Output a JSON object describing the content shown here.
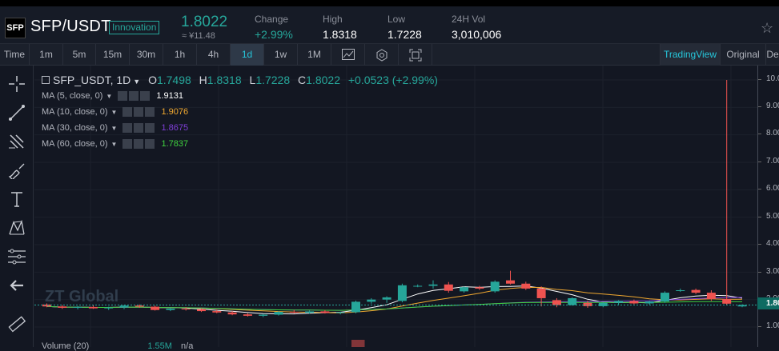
{
  "header": {
    "logo_text": "SFP",
    "pair": "SFP/USDT",
    "badge": "Innovation",
    "price": "1.8022",
    "price_cny": "≈ ¥11.48",
    "change_label": "Change",
    "change_value": "+2.99%",
    "high_label": "High",
    "high_value": "1.8318",
    "low_label": "Low",
    "low_value": "1.7228",
    "vol_label": "24H Vol",
    "vol_value": "3,010,006"
  },
  "timeframes": [
    "Time",
    "1m",
    "5m",
    "15m",
    "30m",
    "1h",
    "4h",
    "1d",
    "1w",
    "1M"
  ],
  "active_timeframe": "1d",
  "icons": [
    "bar-chart-icon",
    "settings-hex-icon",
    "fullscreen-icon"
  ],
  "views": {
    "tradingview": "TradingView",
    "original": "Original",
    "depth": "De"
  },
  "toolbar_icons": [
    "crosshair-icon",
    "trend-line-icon",
    "fib-icon",
    "brush-icon",
    "text-icon",
    "pattern-icon",
    "measure-icon",
    "back-arrow-icon",
    "ruler-icon"
  ],
  "legend": {
    "symbol": "SFP_USDT, 1D",
    "o_key": "O",
    "o_val": "1.7498",
    "h_key": "H",
    "h_val": "1.8318",
    "l_key": "L",
    "l_val": "1.7228",
    "c_key": "C",
    "c_val": "1.8022",
    "chg": "+0.0523 (+2.99%)"
  },
  "mas": [
    {
      "label": "MA (5, close, 0)",
      "value": "1.9131",
      "color": "#ffffff"
    },
    {
      "label": "MA (10, close, 0)",
      "value": "1.9076",
      "color": "#f0a830"
    },
    {
      "label": "MA (30, close, 0)",
      "value": "1.8675",
      "color": "#7e3ed6"
    },
    {
      "label": "MA (60, close, 0)",
      "value": "1.7837",
      "color": "#3fd23f"
    }
  ],
  "volume_row": {
    "label": "Volume (20)",
    "value": "1.55M",
    "extra": "n/a"
  },
  "watermark": "ZT Global",
  "yaxis_ticks": [
    "10.0",
    "9.00",
    "8.00",
    "7.00",
    "6.00",
    "5.00",
    "4.00",
    "3.00",
    "2.00",
    "1.00"
  ],
  "current_price_label": "1.80",
  "chart_data": {
    "type": "candlestick",
    "ylim": [
      0.6,
      10.3
    ],
    "candles": [
      {
        "o": 1.82,
        "h": 1.86,
        "l": 1.72,
        "c": 1.75
      },
      {
        "o": 1.75,
        "h": 1.8,
        "l": 1.66,
        "c": 1.7
      },
      {
        "o": 1.7,
        "h": 1.76,
        "l": 1.64,
        "c": 1.73
      },
      {
        "o": 1.73,
        "h": 1.79,
        "l": 1.66,
        "c": 1.68
      },
      {
        "o": 1.68,
        "h": 1.74,
        "l": 1.62,
        "c": 1.71
      },
      {
        "o": 1.71,
        "h": 1.8,
        "l": 1.65,
        "c": 1.78
      },
      {
        "o": 1.78,
        "h": 1.82,
        "l": 1.7,
        "c": 1.74
      },
      {
        "o": 1.74,
        "h": 1.78,
        "l": 1.6,
        "c": 1.62
      },
      {
        "o": 1.62,
        "h": 1.7,
        "l": 1.58,
        "c": 1.67
      },
      {
        "o": 1.67,
        "h": 1.72,
        "l": 1.6,
        "c": 1.65
      },
      {
        "o": 1.65,
        "h": 1.68,
        "l": 1.55,
        "c": 1.58
      },
      {
        "o": 1.58,
        "h": 1.64,
        "l": 1.5,
        "c": 1.53
      },
      {
        "o": 1.53,
        "h": 1.58,
        "l": 1.43,
        "c": 1.46
      },
      {
        "o": 1.46,
        "h": 1.5,
        "l": 1.38,
        "c": 1.41
      },
      {
        "o": 1.41,
        "h": 1.48,
        "l": 1.36,
        "c": 1.45
      },
      {
        "o": 1.45,
        "h": 1.58,
        "l": 1.42,
        "c": 1.55
      },
      {
        "o": 1.55,
        "h": 1.62,
        "l": 1.5,
        "c": 1.52
      },
      {
        "o": 1.52,
        "h": 1.6,
        "l": 1.48,
        "c": 1.57
      },
      {
        "o": 1.57,
        "h": 1.62,
        "l": 1.49,
        "c": 1.51
      },
      {
        "o": 1.51,
        "h": 1.56,
        "l": 1.46,
        "c": 1.54
      },
      {
        "o": 1.54,
        "h": 1.96,
        "l": 1.5,
        "c": 1.92
      },
      {
        "o": 1.92,
        "h": 2.05,
        "l": 1.85,
        "c": 2.0
      },
      {
        "o": 2.0,
        "h": 2.12,
        "l": 1.88,
        "c": 2.08
      },
      {
        "o": 1.95,
        "h": 2.58,
        "l": 1.9,
        "c": 2.52
      },
      {
        "o": 2.5,
        "h": 2.55,
        "l": 2.45,
        "c": 2.5
      },
      {
        "o": 2.5,
        "h": 2.7,
        "l": 2.4,
        "c": 2.55
      },
      {
        "o": 2.55,
        "h": 2.64,
        "l": 2.25,
        "c": 2.32
      },
      {
        "o": 2.3,
        "h": 2.48,
        "l": 2.25,
        "c": 2.45
      },
      {
        "o": 2.45,
        "h": 2.5,
        "l": 2.35,
        "c": 2.4
      },
      {
        "o": 2.3,
        "h": 2.7,
        "l": 2.25,
        "c": 2.65
      },
      {
        "o": 2.7,
        "h": 3.05,
        "l": 2.55,
        "c": 2.58
      },
      {
        "o": 2.58,
        "h": 2.65,
        "l": 2.35,
        "c": 2.4
      },
      {
        "o": 2.4,
        "h": 2.48,
        "l": 1.75,
        "c": 2.05
      },
      {
        "o": 1.98,
        "h": 2.05,
        "l": 1.72,
        "c": 1.8
      },
      {
        "o": 1.8,
        "h": 2.08,
        "l": 1.78,
        "c": 2.05
      },
      {
        "o": 1.88,
        "h": 1.96,
        "l": 1.7,
        "c": 1.76
      },
      {
        "o": 1.76,
        "h": 1.9,
        "l": 1.72,
        "c": 1.88
      },
      {
        "o": 1.88,
        "h": 1.98,
        "l": 1.8,
        "c": 1.95
      },
      {
        "o": 1.95,
        "h": 2.0,
        "l": 1.83,
        "c": 1.86
      },
      {
        "o": 1.86,
        "h": 1.96,
        "l": 1.82,
        "c": 1.93
      },
      {
        "o": 1.93,
        "h": 2.3,
        "l": 1.88,
        "c": 2.25
      },
      {
        "o": 2.32,
        "h": 2.4,
        "l": 2.28,
        "c": 2.34
      },
      {
        "o": 2.35,
        "h": 2.4,
        "l": 2.2,
        "c": 2.25
      },
      {
        "o": 2.25,
        "h": 2.34,
        "l": 1.95,
        "c": 2.02
      },
      {
        "o": 2.02,
        "h": 10.0,
        "l": 1.8,
        "c": 1.85
      },
      {
        "o": 1.75,
        "h": 1.83,
        "l": 1.72,
        "c": 1.8
      }
    ],
    "ma_series": [
      {
        "name": "MA (5, close, 0)",
        "color": "#ffffff"
      },
      {
        "name": "MA (10, close, 0)",
        "color": "#f0a830"
      },
      {
        "name": "MA (30, close, 0)",
        "color": "#7e3ed6"
      },
      {
        "name": "MA (60, close, 0)",
        "color": "#3fd23f"
      }
    ]
  }
}
